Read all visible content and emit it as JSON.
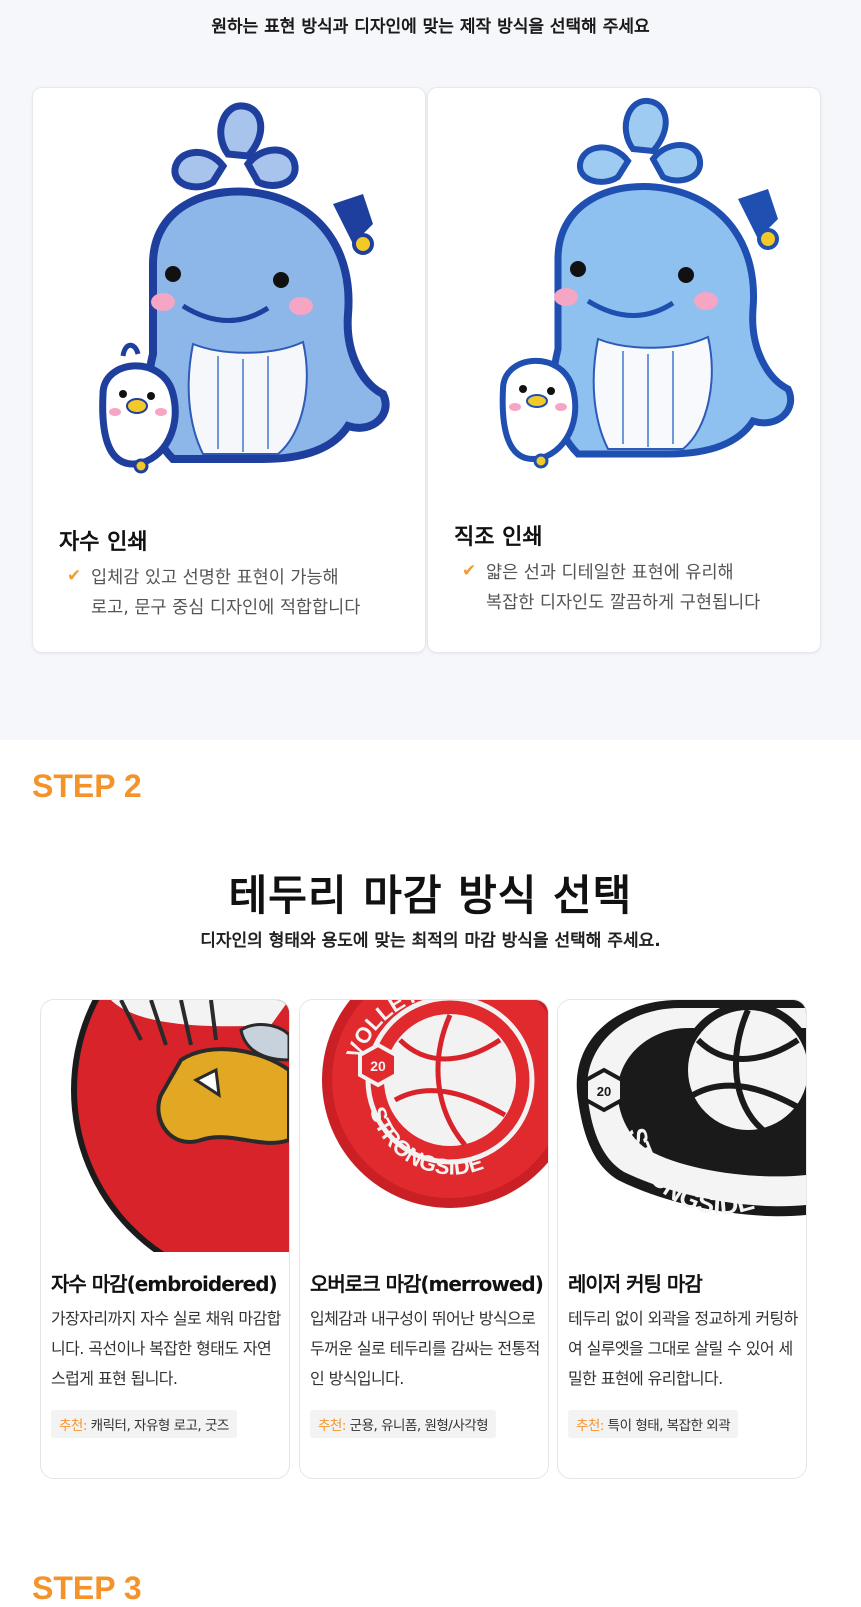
{
  "step1": {
    "intro": "원하는 표현 방식과 디자인에 맞는 제작 방식을 선택해 주세요",
    "cards": [
      {
        "title": "자수 인쇄",
        "check": "✔",
        "desc_line1": "입체감 있고 선명한 표현이 가능해",
        "desc_line2": "로고, 문구 중심 디자인에 적합합니다"
      },
      {
        "title": "직조 인쇄",
        "check": "✔",
        "desc_line1": "얇은 선과 디테일한 표현에 유리해",
        "desc_line2": "복잡한 디자인도 깔끔하게 구현됩니다"
      }
    ]
  },
  "step2": {
    "label": "STEP 2",
    "title": "테두리 마감 방식 선택",
    "subtitle": "디자인의 형태와 용도에 맞는 최적의 마감 방식을 선택해 주세요.",
    "cards": [
      {
        "title": "자수 마감(embroidered)",
        "desc": "가장자리까지 자수 실로 채워 마감합니다.  곡선이나 복잡한 형태도 자연스럽게 표현 됩니다.",
        "rec_label": "추천:",
        "rec_value": " 캐릭터, 자유형 로고, 굿즈"
      },
      {
        "title": "오버로크 마감(merrowed)",
        "desc": "입체감과 내구성이 뛰어난 방식으로 두꺼운 실로 테두리를 감싸는 전통적인 방식입니다.",
        "rec_label": "추천:",
        "rec_value": " 군용, 유니폼, 원형/사각형",
        "patch_text_top": "VOLLEYBALL",
        "patch_text_bottom": "STRONGSIDE",
        "patch_number": "20"
      },
      {
        "title": "레이저 커팅 마감",
        "desc": "테두리 없이 외곽을 정교하게 커팅하여 실루엣을 그대로 살릴 수 있어 세밀한 표현에 유리합니다.",
        "rec_label": "추천:",
        "rec_value": " 특이 형태, 복잡한 외곽",
        "patch_text_bottom": "STRONGSIDE",
        "patch_number": "20"
      }
    ]
  },
  "step3": {
    "label": "STEP 3"
  },
  "colors": {
    "accent": "#f5932b",
    "check": "#f29c2b",
    "whale_outline": "#1f3f9e",
    "whale_body": "#8db7e8",
    "red_patch": "#d9252a"
  }
}
